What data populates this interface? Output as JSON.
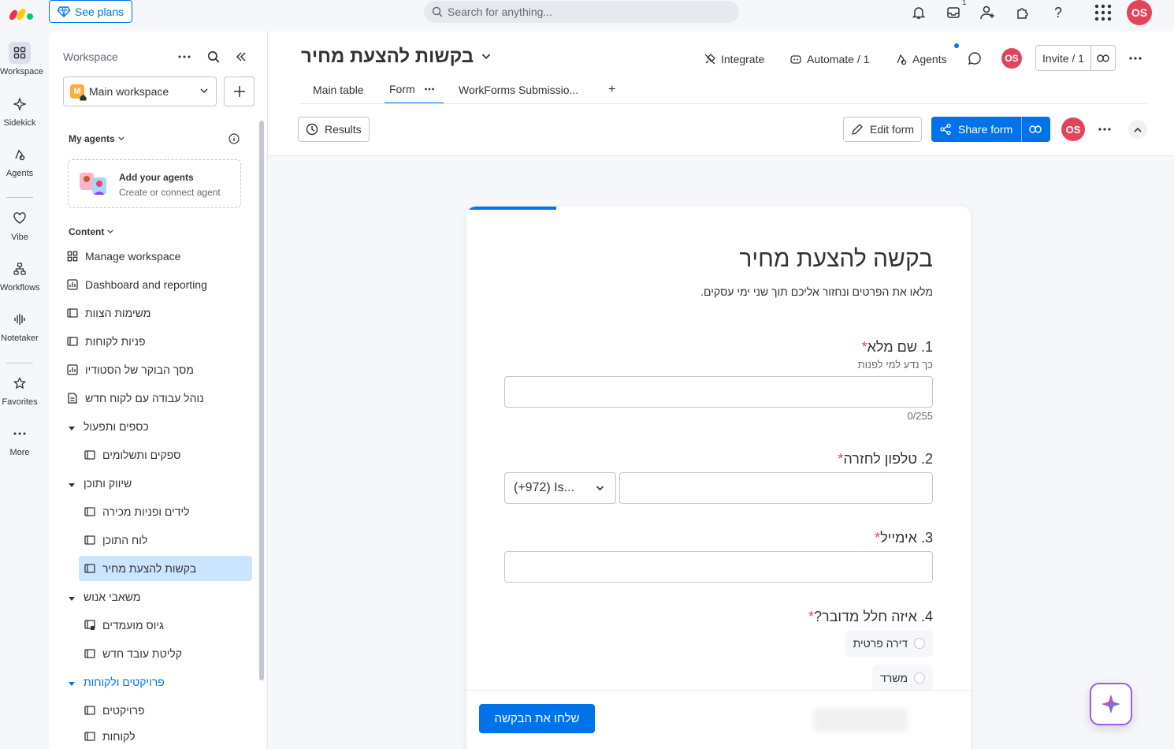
{
  "topbar": {
    "see_plans": "See plans",
    "search_placeholder": "Search for anything...",
    "inbox_count": "1",
    "user_initials": "OS"
  },
  "rail": {
    "items": [
      "Workspace",
      "Sidekick",
      "Agents",
      "Vibe",
      "Workflows",
      "Notetaker",
      "Favorites",
      "More"
    ]
  },
  "sidebar": {
    "workspace_label": "Workspace",
    "workspace_name": "Main workspace",
    "workspace_initial": "M",
    "my_agents": "My agents",
    "agents_card_title": "Add your agents",
    "agents_card_sub": "Create or connect agent",
    "content": "Content",
    "items": [
      {
        "label": "Manage workspace"
      },
      {
        "label": "Dashboard and reporting"
      },
      {
        "label": "משימות הצוות"
      },
      {
        "label": "פניות לקוחות"
      },
      {
        "label": "מסך הבוקר של הסטודיו"
      },
      {
        "label": "נוהל עבודה עם לקוח חדש"
      },
      {
        "label": "כספים ותפעול"
      },
      {
        "label": "ספקים ותשלומים"
      },
      {
        "label": "שיווק ותוכן"
      },
      {
        "label": "לידים ופניות מכירה"
      },
      {
        "label": "לוח התוכן"
      },
      {
        "label": "בקשות להצעת מחיר"
      },
      {
        "label": "משאבי אנוש"
      },
      {
        "label": "גיוס מועמדים"
      },
      {
        "label": "קליטת עובד חדש"
      },
      {
        "label": "פרויקטים ולקוחות"
      },
      {
        "label": "פרויקטים"
      },
      {
        "label": "לקוחות"
      }
    ]
  },
  "board": {
    "title": "בקשות להצעת מחיר",
    "integrate": "Integrate",
    "automate": "Automate / 1",
    "agents": "Agents",
    "invite": "Invite / 1",
    "tabs": [
      "Main table",
      "Form",
      "WorkForms Submissio...",
      "+"
    ]
  },
  "toolbar": {
    "results": "Results",
    "edit_form": "Edit form",
    "share_form": "Share form"
  },
  "form": {
    "title": "בקשה להצעת מחיר",
    "description": "מלאו את הפרטים ונחזור אליכם תוך שני ימי עסקים.",
    "q1_label": "1. שם מלא",
    "q1_help": "כך נדע למי לפנות",
    "q1_counter": "0/255",
    "q2_label": "2. טלפון לחזרה",
    "q2_country": "(+972) Is...",
    "q3_label": "3. אימייל",
    "q4_label": "4. איזה חלל מדובר?",
    "q4_options": [
      "דירה פרטית",
      "משרד"
    ],
    "required_mark": "*",
    "submit": "שלחו את הבקשה"
  }
}
